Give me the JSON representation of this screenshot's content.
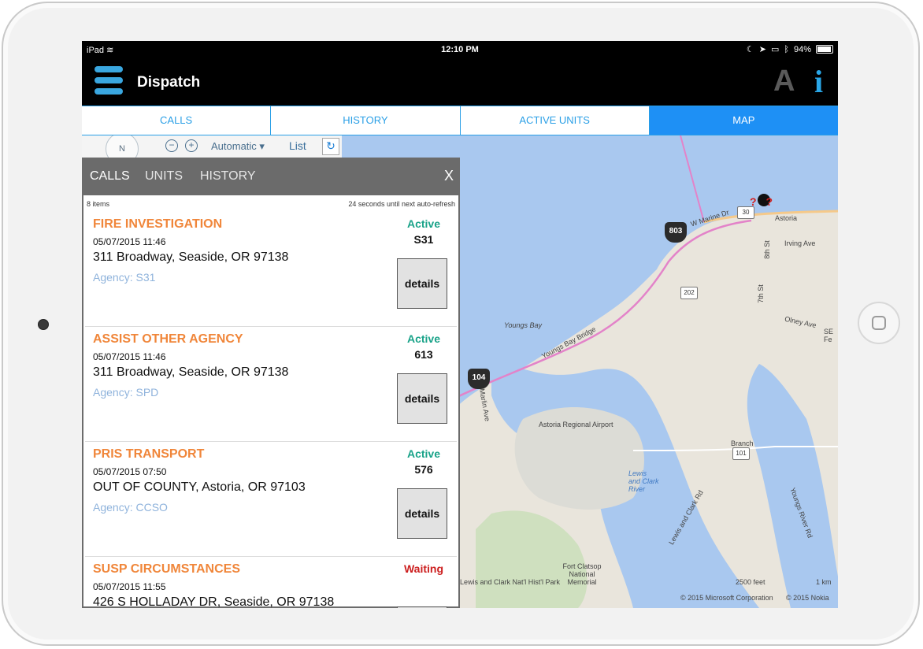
{
  "status_bar": {
    "device": "iPad",
    "time": "12:10 PM",
    "battery": "94%",
    "battery_level": 0.94
  },
  "nav": {
    "title": "Dispatch",
    "font_button": "A",
    "info_button": "i"
  },
  "tabs": [
    {
      "label": "CALLS",
      "active": false
    },
    {
      "label": "HISTORY",
      "active": false
    },
    {
      "label": "ACTIVE UNITS",
      "active": false
    },
    {
      "label": "MAP",
      "active": true
    }
  ],
  "map_toolbar": {
    "compass": "N",
    "zoom_out": "−",
    "zoom_in": "+",
    "mode": "Automatic ▾",
    "list_label": "List",
    "refresh": "↻"
  },
  "panel": {
    "tabs": [
      "CALLS",
      "UNITS",
      "HISTORY"
    ],
    "close": "X",
    "item_count": "8 items",
    "refresh_note": "24 seconds until next auto-refresh",
    "details_label": "details",
    "calls": [
      {
        "type": "FIRE INVESTIGATION",
        "time": "05/07/2015 11:46",
        "address": "311 Broadway, Seaside, OR 97138",
        "agency": "Agency: S31",
        "status": "Active",
        "unit": "S31",
        "status_color": "#1aa389"
      },
      {
        "type": "ASSIST OTHER AGENCY",
        "time": "05/07/2015 11:46",
        "address": "311 Broadway, Seaside, OR 97138",
        "agency": "Agency: SPD",
        "status": "Active",
        "unit": "613",
        "status_color": "#1aa389"
      },
      {
        "type": "PRIS TRANSPORT",
        "time": "05/07/2015 07:50",
        "address": "OUT OF COUNTY, Astoria, OR 97103",
        "agency": "Agency: CCSO",
        "status": "Active",
        "unit": "576",
        "status_color": "#1aa389"
      },
      {
        "type": "SUSP CIRCUMSTANCES",
        "time": "05/07/2015 11:55",
        "address": "426 S HOLLADAY DR, Seaside, OR 97138",
        "agency": "",
        "status": "Waiting",
        "unit": "",
        "status_color": "#cc1f1f"
      }
    ]
  },
  "map": {
    "water_color": "#a9c8ef",
    "land_color": "#e9e5dc",
    "labels": {
      "youngs_bay": "Youngs Bay",
      "youngs_bay_bridge": "Youngs Bay Bridge",
      "w_marine_dr": "W Marine Dr",
      "astoria": "Astoria",
      "irving_ave": "Irving Ave",
      "eighth_st": "8th St",
      "seventh_st": "7th St",
      "olney_ave": "Olney Ave",
      "se_fe": "SE Fe",
      "airport": "Astoria Regional Airport",
      "lewis_clark_river": "Lewis and Clark River",
      "lewis_clark_rd": "Lewis and Clark Rd",
      "youngs_river_rd": "Youngs River Rd",
      "branch": "Branch",
      "fort_clatsop": "Fort Clatsop National Memorial",
      "nhp": "Lewis and Clark Nat'l Hist'l Park",
      "se_marlin_ave": "SE Marlin Ave",
      "scale_feet": "2500 feet",
      "scale_km": "1 km",
      "copyright_ms": "© 2015 Microsoft Corporation",
      "copyright_nokia": "© 2015 Nokia"
    },
    "shields": [
      "202",
      "30",
      "101"
    ],
    "unit_badges": [
      "803",
      "104"
    ],
    "call_marker": "??"
  }
}
